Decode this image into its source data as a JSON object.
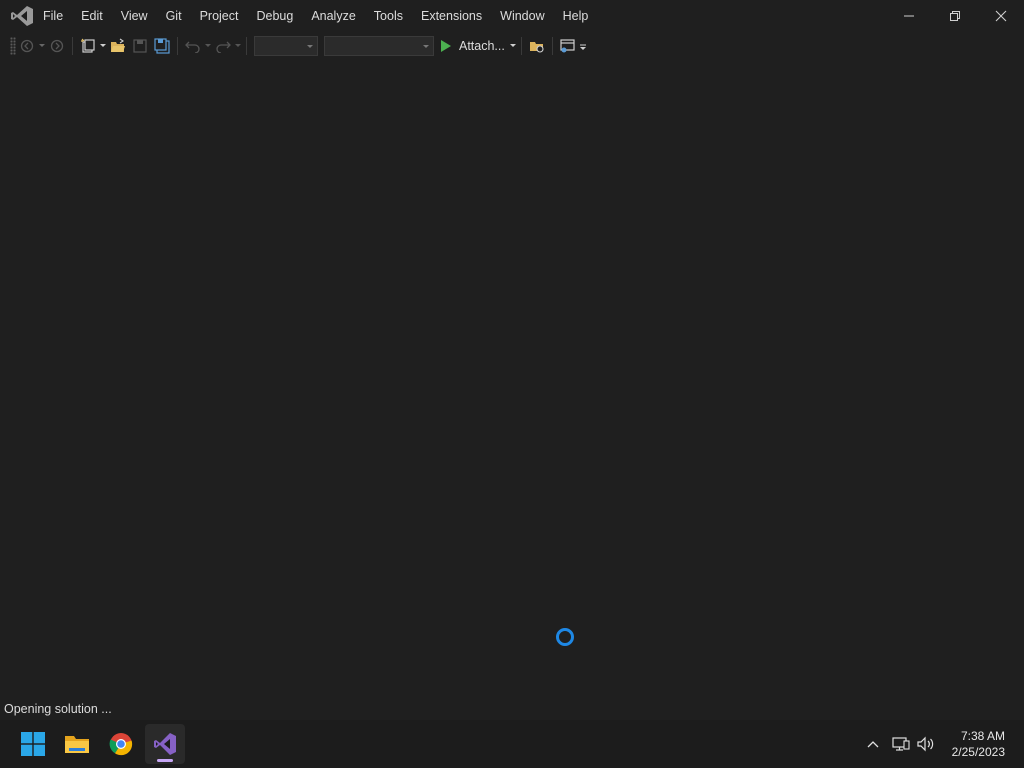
{
  "menu": {
    "items": [
      "File",
      "Edit",
      "View",
      "Git",
      "Project",
      "Debug",
      "Analyze",
      "Tools",
      "Extensions",
      "Window",
      "Help"
    ]
  },
  "window_controls": {
    "icons": [
      "minimize-icon",
      "restore-icon",
      "close-icon"
    ]
  },
  "toolbar": {
    "attach_label": "Attach...",
    "config_combo_value": "",
    "platform_combo_value": ""
  },
  "status": {
    "text": "Opening solution ..."
  },
  "taskbar": {
    "apps": [
      "start",
      "file-explorer",
      "chrome",
      "visual-studio"
    ],
    "active_app": "visual-studio"
  },
  "clock": {
    "time": "7:38 AM",
    "date": "2/25/2023"
  },
  "colors": {
    "background": "#1f1f1f",
    "spinner": "#1e88e5",
    "play": "#4caf50",
    "vs_accent": "#8661c5"
  }
}
